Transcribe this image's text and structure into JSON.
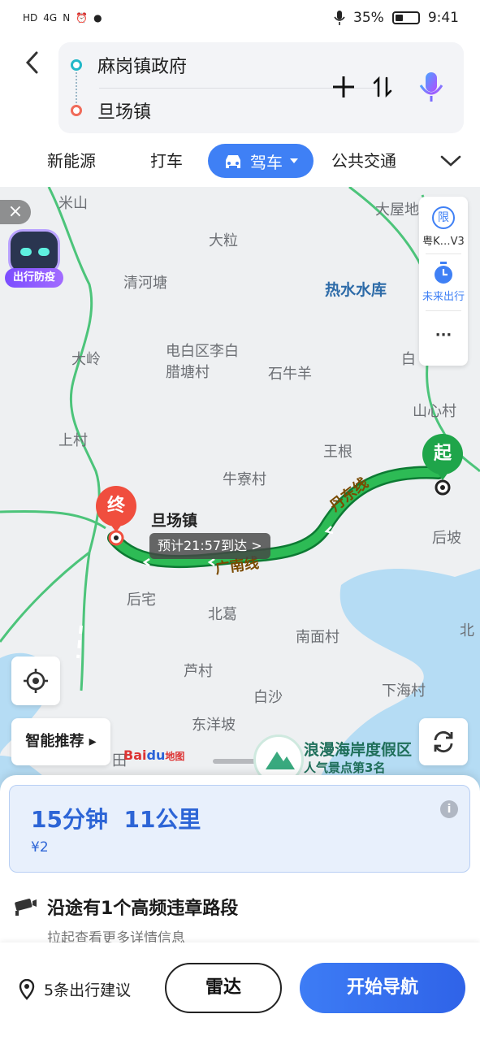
{
  "status_bar": {
    "network_indicators": [
      "HD",
      "4G",
      "N",
      "⏰",
      "●"
    ],
    "battery_percent": "35%",
    "battery_level": 0.35,
    "time": "9:41"
  },
  "route": {
    "origin": "麻岗镇政府",
    "destination": "旦场镇"
  },
  "modes": {
    "items": [
      "新能源",
      "打车",
      "驾车",
      "公共交通"
    ],
    "active": "驾车"
  },
  "map": {
    "place_labels": {
      "mishan": "米山",
      "dali": "大粒",
      "qinghetang": "清河塘",
      "dawudi": "大屋地",
      "reshui": "热水水库",
      "daling": "大岭",
      "dianbai1": "电白区李白",
      "dianbai2": "腊塘村",
      "shiniuyang": "石牛羊",
      "bai": "白",
      "shanxin": "山心村",
      "shangcun": "上村",
      "wanggen": "王根",
      "niuliao": "牛寮村",
      "danchang": "旦场镇",
      "houpo": "后坡",
      "houzhai": "后宅",
      "beige": "北葛",
      "nanmian": "南面村",
      "bei": "北",
      "lucun": "芦村",
      "baisha": "白沙",
      "xiahai": "下海村",
      "dongyangpo": "东洋坡",
      "tian": "田"
    },
    "road_labels": {
      "dandong": "丹东线",
      "guangnan": "广南线"
    },
    "close_chip": "×",
    "epidemic_badge": "出行防疫",
    "side_panel": {
      "limit_icon": "限",
      "limit_label": "粤K…V3",
      "future_label": "未来出行",
      "more": "···"
    },
    "end_pin": "终",
    "start_pin": "起",
    "eta": "预计21:57到达 >",
    "smart_recommend": "智能推荐 ▸",
    "baidu_logo": {
      "bai": "Bai",
      "paw": "du",
      "map": "地图"
    },
    "poi": {
      "title": "浪漫海岸度假区",
      "subtitle": "人气景点第3名"
    }
  },
  "summary": {
    "time": "15分钟",
    "distance": "11公里",
    "toll": "¥2",
    "info_icon": "i",
    "camera_text": "沿途有1个高频违章路段",
    "camera_sub": "拉起查看更多详情信息"
  },
  "actions": {
    "trip_tips": "5条出行建议",
    "radar": "雷达",
    "start_nav": "开始导航"
  },
  "colors": {
    "accent": "#3f80f5",
    "route_green": "#1fa54a",
    "end_pin": "#f04e3e",
    "start_pin": "#1fa54a"
  }
}
